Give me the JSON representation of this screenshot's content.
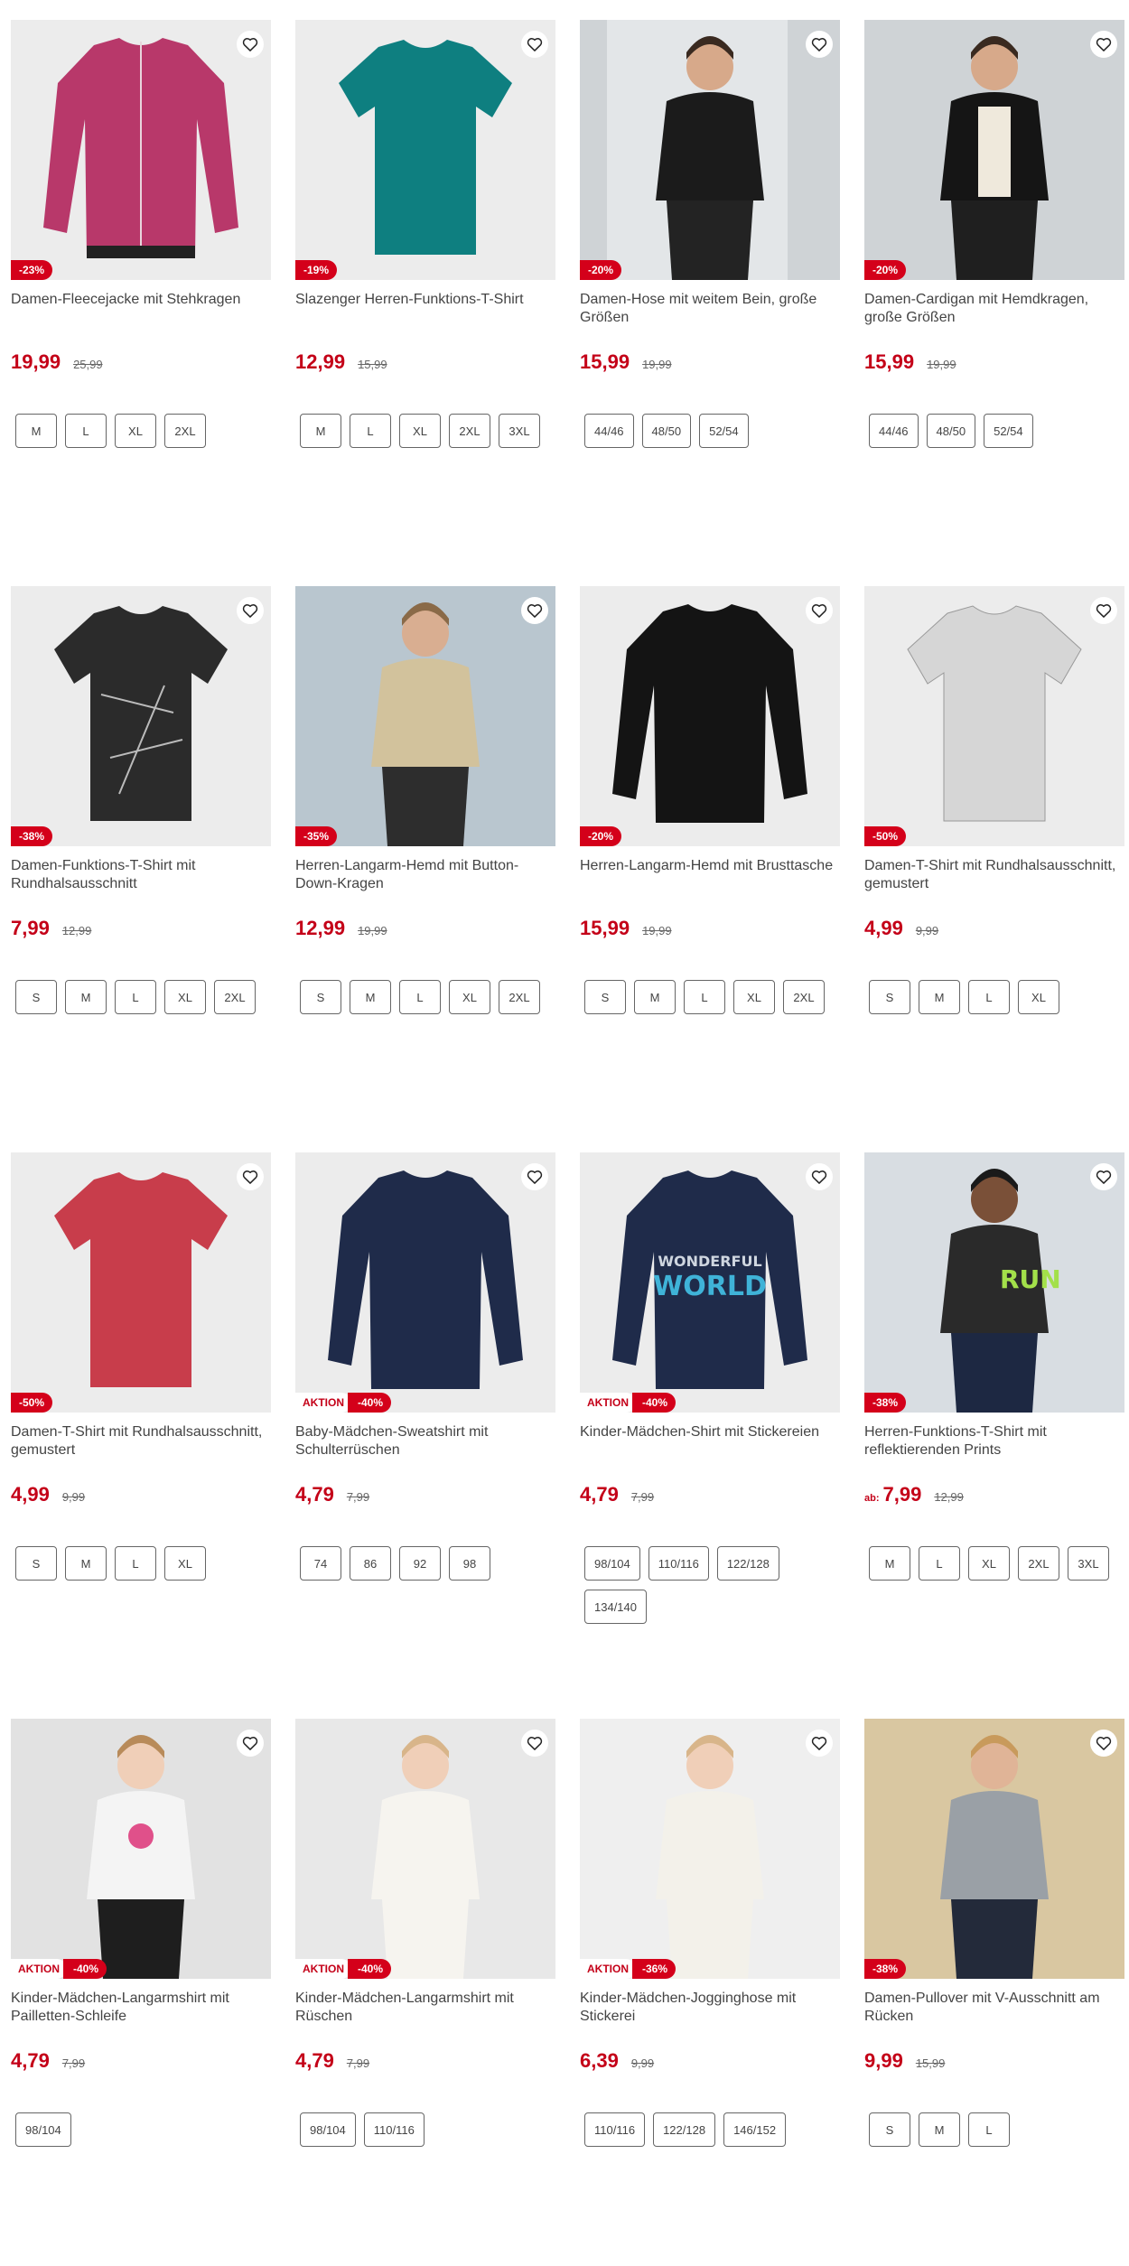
{
  "colors": {
    "accent": "#c40018",
    "badge": "#d4001a"
  },
  "icons": {
    "wishlist": "heart-icon"
  },
  "products": [
    {
      "title": "Damen-Fleecejacke mit Stehkragen",
      "price": "19,99",
      "old_price": "25,99",
      "discount": "-23%",
      "aktion": "",
      "from": "",
      "sizes": [
        "M",
        "L",
        "XL",
        "2XL"
      ],
      "art": "fleece"
    },
    {
      "title": "Slazenger Herren-Funktions-T-Shirt",
      "price": "12,99",
      "old_price": "15,99",
      "discount": "-19%",
      "aktion": "",
      "from": "",
      "sizes": [
        "M",
        "L",
        "XL",
        "2XL",
        "3XL"
      ],
      "art": "teal"
    },
    {
      "title": "Damen-Hose mit weitem Bein, große Größen",
      "price": "15,99",
      "old_price": "19,99",
      "discount": "-20%",
      "aktion": "",
      "from": "",
      "sizes": [
        "44/46",
        "48/50",
        "52/54"
      ],
      "art": "woman-black"
    },
    {
      "title": "Damen-Cardigan mit Hemdkragen, große Größen",
      "price": "15,99",
      "old_price": "19,99",
      "discount": "-20%",
      "aktion": "",
      "from": "",
      "sizes": [
        "44/46",
        "48/50",
        "52/54"
      ],
      "art": "woman-black2"
    },
    {
      "title": "Damen-Funktions-T-Shirt mit Rundhalsausschnitt",
      "price": "7,99",
      "old_price": "12,99",
      "discount": "-38%",
      "aktion": "",
      "from": "",
      "sizes": [
        "S",
        "M",
        "L",
        "XL",
        "2XL"
      ],
      "art": "dark-tee"
    },
    {
      "title": "Herren-Langarm-Hemd mit Button-Down-Kragen",
      "price": "12,99",
      "old_price": "19,99",
      "discount": "-35%",
      "aktion": "",
      "from": "",
      "sizes": [
        "S",
        "M",
        "L",
        "XL",
        "2XL"
      ],
      "art": "man-shirt"
    },
    {
      "title": "Herren-Langarm-Hemd mit Brusttasche",
      "price": "15,99",
      "old_price": "19,99",
      "discount": "-20%",
      "aktion": "",
      "from": "",
      "sizes": [
        "S",
        "M",
        "L",
        "XL",
        "2XL"
      ],
      "art": "black-shirt"
    },
    {
      "title": "Damen-T-Shirt mit Rundhalsausschnitt, gemustert",
      "price": "4,99",
      "old_price": "9,99",
      "discount": "-50%",
      "aktion": "",
      "from": "",
      "sizes": [
        "S",
        "M",
        "L",
        "XL"
      ],
      "art": "grey-tee"
    },
    {
      "title": "Damen-T-Shirt mit Rundhalsausschnitt, gemustert",
      "price": "4,99",
      "old_price": "9,99",
      "discount": "-50%",
      "aktion": "",
      "from": "",
      "sizes": [
        "S",
        "M",
        "L",
        "XL"
      ],
      "art": "red-tee"
    },
    {
      "title": "Baby-Mädchen-Sweatshirt mit Schulterrüschen",
      "price": "4,79",
      "old_price": "7,99",
      "discount": "-40%",
      "aktion": "AKTION",
      "from": "",
      "sizes": [
        "74",
        "86",
        "92",
        "98"
      ],
      "art": "navy-sweat"
    },
    {
      "title": "Kinder-Mädchen-Shirt mit Stickereien",
      "price": "4,79",
      "old_price": "7,99",
      "discount": "-40%",
      "aktion": "AKTION",
      "from": "",
      "sizes": [
        "98/104",
        "110/116",
        "122/128",
        "134/140"
      ],
      "art": "world",
      "art_text_1": "WONDERFUL",
      "art_text_2": "WORLD"
    },
    {
      "title": "Herren-Funktions-T-Shirt mit reflektierenden Prints",
      "price": "7,99",
      "old_price": "12,99",
      "discount": "-38%",
      "aktion": "",
      "from": "ab:",
      "sizes": [
        "M",
        "L",
        "XL",
        "2XL",
        "3XL"
      ],
      "art": "run",
      "art_text_1": "RUN"
    },
    {
      "title": "Kinder-Mädchen-Langarmshirt mit Pailletten-Schleife",
      "price": "4,79",
      "old_price": "7,99",
      "discount": "-40%",
      "aktion": "AKTION",
      "from": "",
      "sizes": [
        "98/104"
      ],
      "art": "girl1"
    },
    {
      "title": "Kinder-Mädchen-Langarmshirt mit Rüschen",
      "price": "4,79",
      "old_price": "7,99",
      "discount": "-40%",
      "aktion": "AKTION",
      "from": "",
      "sizes": [
        "98/104",
        "110/116"
      ],
      "art": "girl2"
    },
    {
      "title": "Kinder-Mädchen-Jogginghose mit Stickerei",
      "price": "6,39",
      "old_price": "9,99",
      "discount": "-36%",
      "aktion": "AKTION",
      "from": "",
      "sizes": [
        "110/116",
        "122/128",
        "146/152"
      ],
      "art": "girl3"
    },
    {
      "title": "Damen-Pullover mit V-Ausschnitt am Rücken",
      "price": "9,99",
      "old_price": "15,99",
      "discount": "-38%",
      "aktion": "",
      "from": "",
      "sizes": [
        "S",
        "M",
        "L"
      ],
      "art": "woman-grey"
    }
  ]
}
